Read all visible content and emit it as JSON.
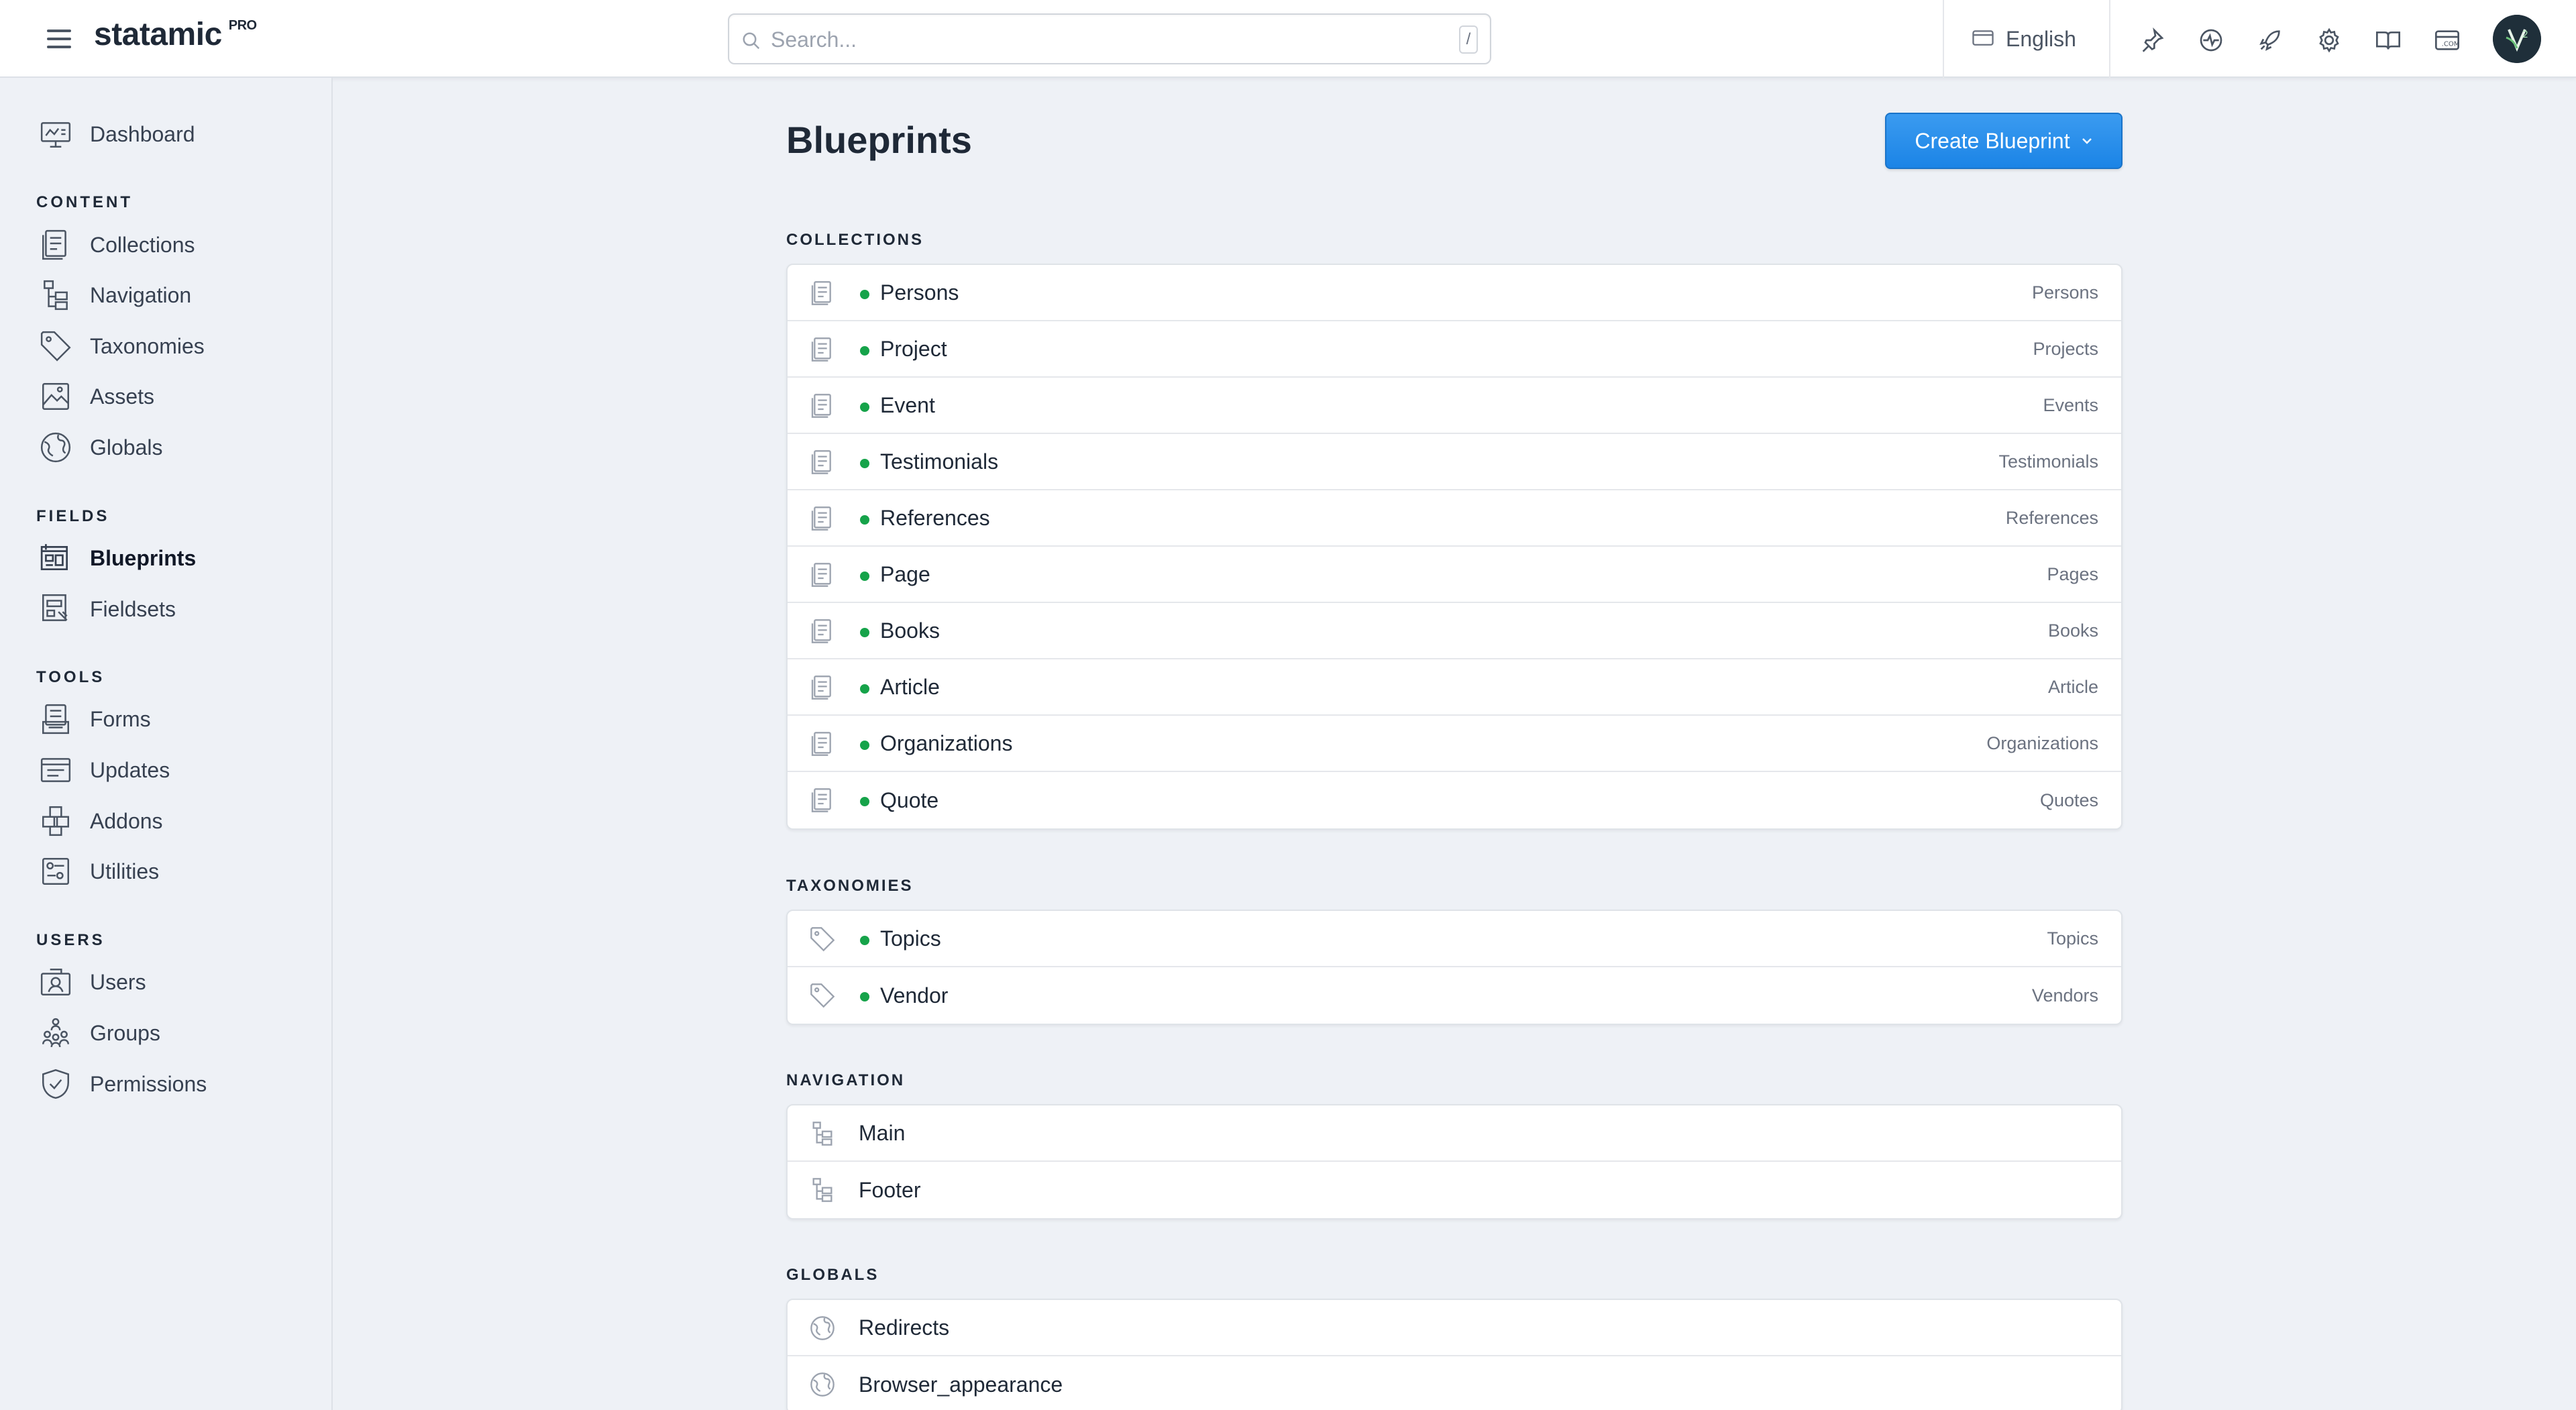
{
  "app": {
    "logo": "statamic",
    "edition": "PRO"
  },
  "search": {
    "placeholder": "Search...",
    "shortcut": "/"
  },
  "site_selector": {
    "label": "English"
  },
  "top_icons": [
    "pin-icon",
    "pulse-icon",
    "rocket-icon",
    "settings-icon",
    "docs-icon",
    "dotcom-icon"
  ],
  "sidebar": {
    "dashboard": "Dashboard",
    "sections": [
      {
        "heading": "CONTENT",
        "items": [
          "Collections",
          "Navigation",
          "Taxonomies",
          "Assets",
          "Globals"
        ]
      },
      {
        "heading": "FIELDS",
        "items": [
          "Blueprints",
          "Fieldsets"
        ]
      },
      {
        "heading": "TOOLS",
        "items": [
          "Forms",
          "Updates",
          "Addons",
          "Utilities"
        ]
      },
      {
        "heading": "USERS",
        "items": [
          "Users",
          "Groups",
          "Permissions"
        ]
      }
    ],
    "active": "Blueprints"
  },
  "main": {
    "title": "Blueprints",
    "create_button": "Create Blueprint",
    "collections": {
      "heading": "COLLECTIONS",
      "rows": [
        {
          "name": "Persons",
          "tag": "Persons"
        },
        {
          "name": "Project",
          "tag": "Projects"
        },
        {
          "name": "Event",
          "tag": "Events"
        },
        {
          "name": "Testimonials",
          "tag": "Testimonials"
        },
        {
          "name": "References",
          "tag": "References"
        },
        {
          "name": "Page",
          "tag": "Pages"
        },
        {
          "name": "Books",
          "tag": "Books"
        },
        {
          "name": "Article",
          "tag": "Article"
        },
        {
          "name": "Organizations",
          "tag": "Organizations"
        },
        {
          "name": "Quote",
          "tag": "Quotes"
        }
      ]
    },
    "taxonomies": {
      "heading": "TAXONOMIES",
      "rows": [
        {
          "name": "Topics",
          "tag": "Topics"
        },
        {
          "name": "Vendor",
          "tag": "Vendors"
        }
      ]
    },
    "navigation": {
      "heading": "NAVIGATION",
      "rows": [
        {
          "name": "Main"
        },
        {
          "name": "Footer"
        }
      ]
    },
    "globals": {
      "heading": "GLOBALS",
      "rows": [
        {
          "name": "Redirects"
        },
        {
          "name": "Browser_appearance"
        }
      ]
    }
  },
  "colors": {
    "accent": "#1b84e6",
    "published_dot": "#16a34a",
    "background": "#eef1f6"
  }
}
